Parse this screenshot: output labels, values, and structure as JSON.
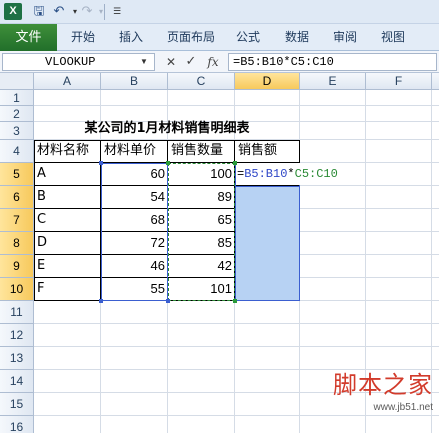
{
  "quick_access": {
    "logo": "X",
    "save_icon": "save-icon",
    "undo_icon": "undo-icon",
    "redo_icon": "redo-icon",
    "customize_icon": "customize-icon"
  },
  "ribbon": {
    "file_tab": "文件",
    "tabs": [
      "开始",
      "插入",
      "页面布局",
      "公式",
      "数据",
      "审阅",
      "视图"
    ]
  },
  "formula_bar": {
    "name_box": "VLOOKUP",
    "cancel_symbol": "✕",
    "enter_symbol": "✓",
    "fx_symbol": "fx",
    "formula": "=B5:B10*C5:C10"
  },
  "columns": [
    "A",
    "B",
    "C",
    "D",
    "E",
    "F"
  ],
  "rows": [
    "1",
    "2",
    "3",
    "4",
    "5",
    "6",
    "7",
    "8",
    "9",
    "10",
    "11",
    "12",
    "13",
    "14",
    "15",
    "16"
  ],
  "sheet": {
    "title": "某公司的1月材料销售明细表",
    "headers": [
      "材料名称",
      "材料单价",
      "销售数量",
      "销售额"
    ],
    "data": [
      {
        "name": "A",
        "price": "60",
        "qty": "100"
      },
      {
        "name": "B",
        "price": "54",
        "qty": "89"
      },
      {
        "name": "C",
        "price": "68",
        "qty": "65"
      },
      {
        "name": "D",
        "price": "72",
        "qty": "85"
      },
      {
        "name": "E",
        "price": "46",
        "qty": "42"
      },
      {
        "name": "F",
        "price": "55",
        "qty": "101"
      }
    ],
    "cell_formula": {
      "eq": "=",
      "ref1": "B5:B10",
      "op": "*",
      "ref2": "C5:C10"
    }
  },
  "watermark": {
    "text": "脚本之家",
    "url": "www.jb51.net"
  },
  "colors": {
    "file_tab": "#216f2a",
    "range_blue": "#3b5fd0",
    "range_green": "#2a8a35",
    "selection_fill": "#b7d2f3",
    "header_highlight": "#f7c95c"
  }
}
